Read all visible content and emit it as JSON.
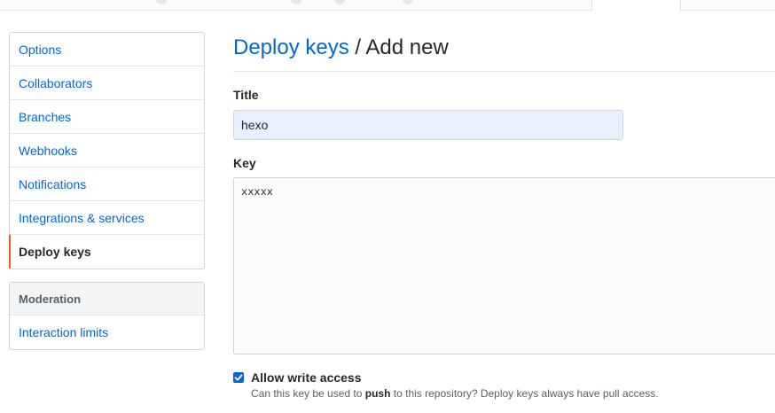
{
  "page": {
    "breadcrumb_parent": "Deploy keys",
    "breadcrumb_separator": "/",
    "breadcrumb_current": "Add new"
  },
  "sidebar": {
    "menu_items": [
      {
        "label": "Options",
        "selected": false
      },
      {
        "label": "Collaborators",
        "selected": false
      },
      {
        "label": "Branches",
        "selected": false
      },
      {
        "label": "Webhooks",
        "selected": false
      },
      {
        "label": "Notifications",
        "selected": false
      },
      {
        "label": "Integrations & services",
        "selected": false
      },
      {
        "label": "Deploy keys",
        "selected": true
      }
    ],
    "moderation": {
      "heading": "Moderation",
      "items": [
        {
          "label": "Interaction limits"
        }
      ]
    }
  },
  "form": {
    "title_label": "Title",
    "title_value": "hexo",
    "key_label": "Key",
    "key_value": "xxxxx",
    "write_access": {
      "checked": true,
      "label": "Allow write access",
      "note_before": "Can this key be used to",
      "note_strong": "push",
      "note_after": "to this repository? Deploy keys always have pull access."
    }
  },
  "colors": {
    "link": "#0366d6",
    "selected_accent": "#e36209",
    "checkbox": "#0366d6",
    "autofill_background": "#e8f0fe"
  }
}
